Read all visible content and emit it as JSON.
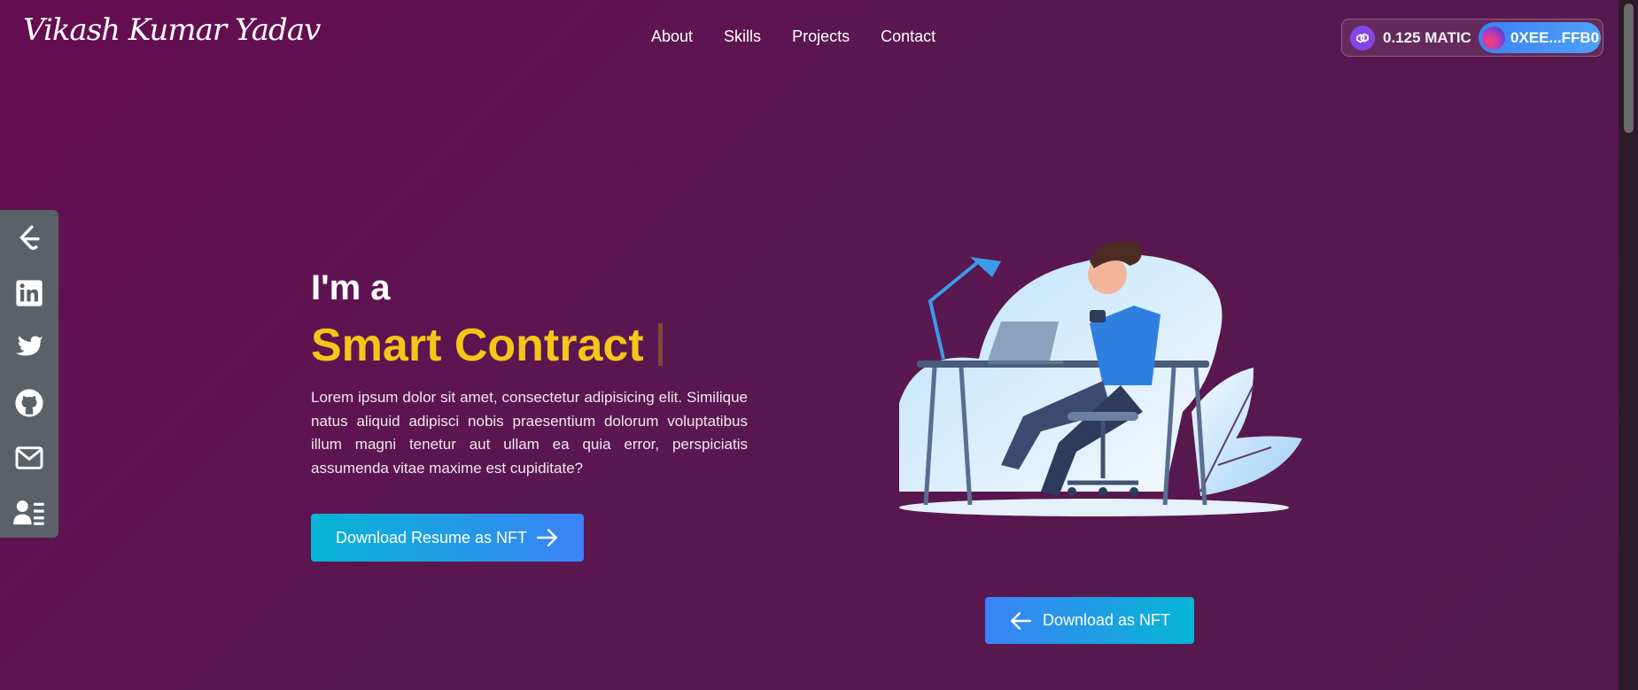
{
  "header": {
    "logo_text": "Vikash Kumar Yadav",
    "nav": [
      {
        "label": "About"
      },
      {
        "label": "Skills"
      },
      {
        "label": "Projects"
      },
      {
        "label": "Contact"
      }
    ]
  },
  "wallet": {
    "balance": "0.125 MATIC",
    "address": "0XEE...FFB0",
    "icon": "polygon-matic-icon"
  },
  "social": {
    "icons": [
      "leetcode-icon",
      "linkedin-icon",
      "twitter-icon",
      "github-icon",
      "mail-icon",
      "resume-icon"
    ]
  },
  "hero": {
    "intro": "I'm a",
    "role": "Smart Contract",
    "description": "Lorem ipsum dolor sit amet, consectetur adipisicing elit. Similique natus aliquid adipisci nobis praesentium dolorum voluptatibus illum magni tenetur aut ullam ea quia error, perspiciatis assumenda vitae maxime est cupiditate?",
    "primary_button": "Download Resume as NFT",
    "secondary_button": "Download as NFT"
  },
  "colors": {
    "background": "#5c1550",
    "accent_yellow": "#f5c518",
    "button_cyan": "#06b6d4",
    "button_blue": "#3b82f6",
    "sidebar": "#5a6268"
  }
}
